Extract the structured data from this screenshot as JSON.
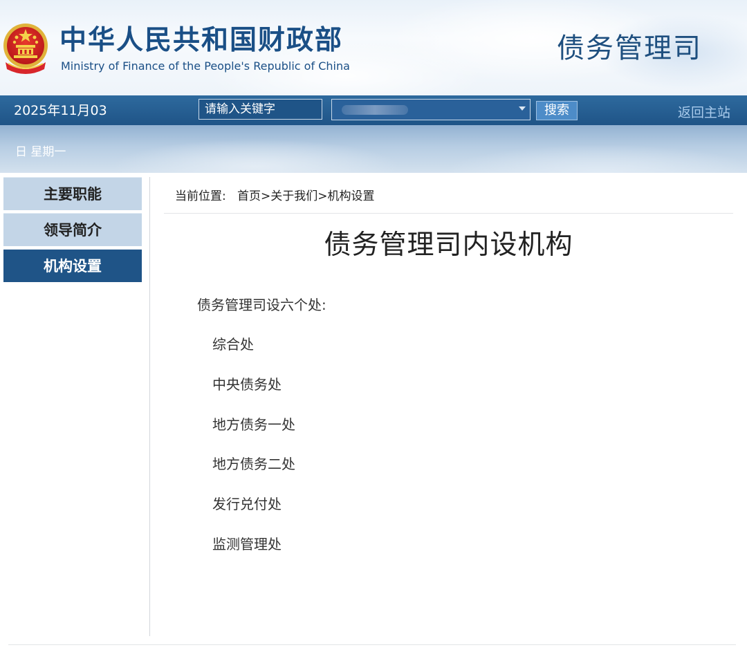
{
  "header": {
    "ministry_name_cn": "中华人民共和国财政部",
    "ministry_name_en": "Ministry of Finance of the People's Republic of China",
    "department_title": "债务管理司"
  },
  "navbar": {
    "date_text": "2025年11月03",
    "search_placeholder": "请输入关键字",
    "search_button_label": "搜索",
    "home_link_label": "返回主站"
  },
  "substrip": {
    "weekday_text": "日  星期一"
  },
  "sidebar": {
    "items": [
      {
        "label": "主要职能",
        "active": false
      },
      {
        "label": "领导简介",
        "active": false
      },
      {
        "label": "机构设置",
        "active": true
      }
    ]
  },
  "breadcrumb": {
    "prefix": "当前位置:",
    "items": [
      "首页",
      "关于我们",
      "机构设置"
    ],
    "separator": ">"
  },
  "content": {
    "title": "债务管理司内设机构",
    "intro": "债务管理司设六个处:",
    "divisions": [
      "综合处",
      "中央债务处",
      "地方债务一处",
      "地方债务二处",
      "发行兑付处",
      "监测管理处"
    ]
  },
  "colors": {
    "brand_blue": "#1f5487",
    "sidebar_inactive": "#c3d5e7",
    "title_blue": "#1a4f86"
  }
}
